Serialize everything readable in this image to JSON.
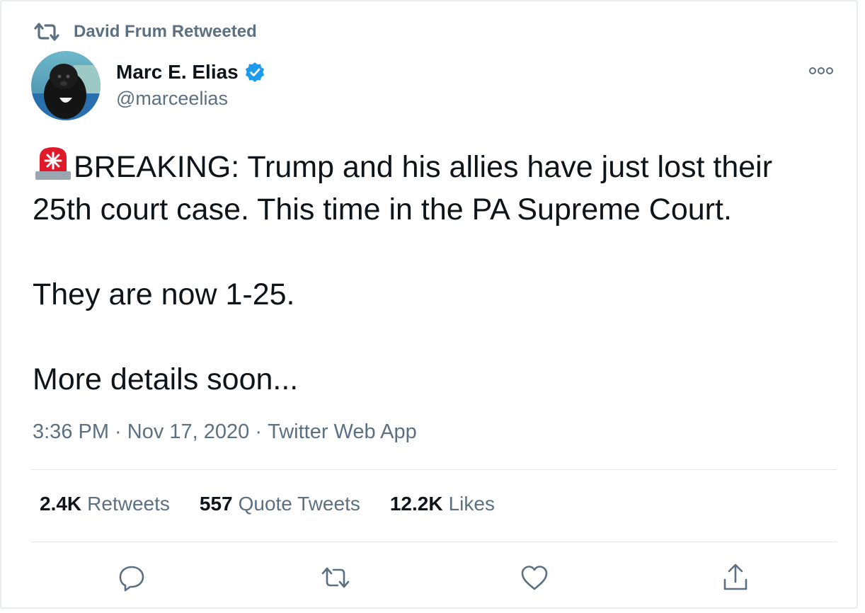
{
  "retweet_context": {
    "label": "David Frum Retweeted",
    "icon": "retweet-icon"
  },
  "author": {
    "name": "Marc E. Elias",
    "handle": "@marceelias",
    "verified": true,
    "avatar": "avatar-dog-photo"
  },
  "tweet": {
    "emoji": "police-siren-icon",
    "paragraphs": [
      "BREAKING: Trump and his allies have just lost their 25th court case. This time in the PA Supreme Court.",
      "They are now 1-25.",
      "More details soon..."
    ]
  },
  "meta": {
    "time": "3:36 PM",
    "separator": " · ",
    "date": "Nov 17, 2020",
    "source": "Twitter Web App"
  },
  "stats": {
    "retweets_count": "2.4K",
    "retweets_label": "Retweets",
    "quotes_count": "557",
    "quotes_label": "Quote Tweets",
    "likes_count": "12.2K",
    "likes_label": "Likes"
  },
  "actions": [
    "reply-icon",
    "retweet-icon",
    "like-icon",
    "share-icon"
  ],
  "colors": {
    "secondary_text": "#5b7083",
    "primary_text": "#0f1419",
    "verified_blue": "#1d9bf0",
    "divider": "#e1e8ed"
  }
}
